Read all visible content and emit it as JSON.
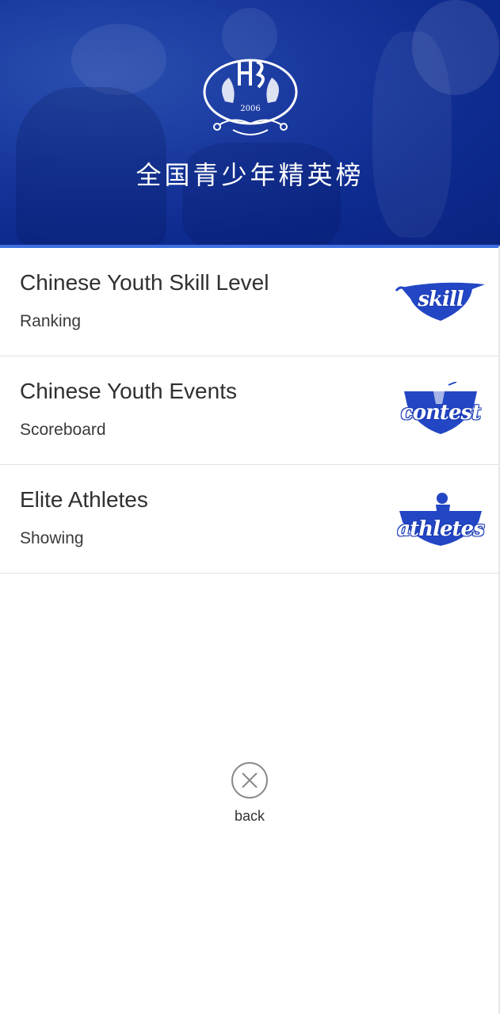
{
  "header": {
    "title": "全国青少年精英榜",
    "emblem_year": "2006",
    "emblem_glyph": "PKE",
    "brand_color": "#0d2a8e"
  },
  "menu": {
    "items": [
      {
        "title": "Chinese Youth Skill Level",
        "subtitle": "Ranking",
        "badge": "skill",
        "icon": "skill-badge-icon"
      },
      {
        "title": "Chinese Youth Events",
        "subtitle": "Scoreboard",
        "badge": "contest",
        "icon": "contest-badge-icon"
      },
      {
        "title": "Elite Athletes",
        "subtitle": "Showing",
        "badge": "athletes",
        "icon": "athletes-badge-icon"
      }
    ]
  },
  "footer": {
    "back_label": "back",
    "back_icon": "close-circle-icon"
  },
  "colors": {
    "accent": "#1f3fb8",
    "divider": "#e2e2e2"
  }
}
